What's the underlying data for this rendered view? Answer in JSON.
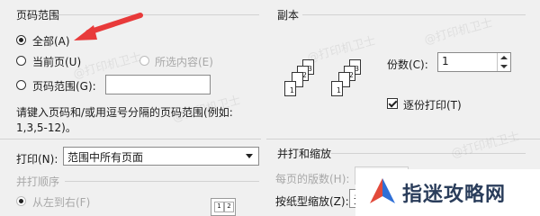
{
  "print_range": {
    "title": "页码范围",
    "all_label": "全部(A)",
    "current_label": "当前页(U)",
    "selection_label": "所选内容(E)",
    "pages_label": "页码范围(G):",
    "pages_value": "",
    "hint_line1": "请键入页码和/或用逗号分隔的页码范围(例如:",
    "hint_line2": "1,3,5-12)。"
  },
  "copies": {
    "title": "副本",
    "count_label": "份数(C):",
    "count_value": "1",
    "collate_label": "逐份打印(T)",
    "collate_checked": true
  },
  "print_what": {
    "label": "打印(N):",
    "selected": "范围中所有页面"
  },
  "order": {
    "title": "并打顺序",
    "left_to_right_label": "从左到右(F)"
  },
  "zoom": {
    "title": "并打和缩放",
    "pages_per_sheet_label": "每页的版数(H):",
    "scale_label": "按纸型缩放(Z):",
    "scale_value": "无"
  },
  "watermark": {
    "text": "@打印机卫士"
  },
  "brand": {
    "name": "指迷攻略网"
  },
  "colors": {
    "arrow": "#e83a3a",
    "brand_text": "#2a3d5b",
    "brand_logo_blue": "#2f6fd6",
    "brand_logo_red": "#e24a3b"
  }
}
